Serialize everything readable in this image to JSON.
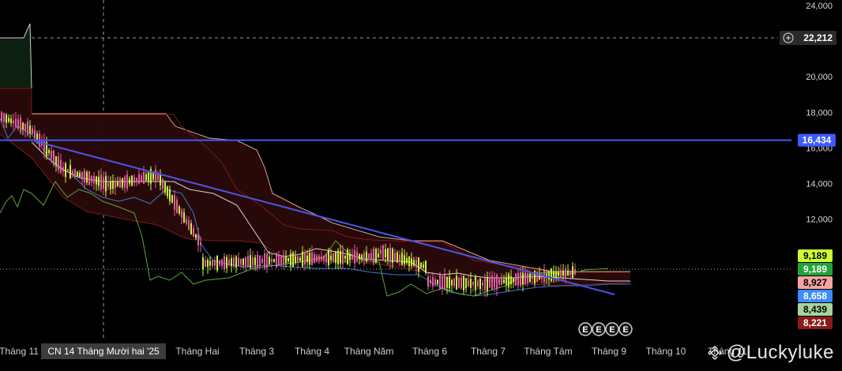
{
  "chart_data": {
    "type": "candlestick",
    "y_axis": {
      "ticks": [
        "24,000",
        "20,000",
        "18,000",
        "16,000",
        "14,000",
        "12,000"
      ],
      "tick_values": [
        24000,
        20000,
        18000,
        16000,
        14000,
        12000
      ],
      "ylim": [
        7300,
        24000
      ]
    },
    "x_axis": {
      "labels": [
        "Tháng 11",
        "Tháng Hai",
        "Tháng 3",
        "Tháng 4",
        "Tháng Năm",
        "Tháng 6",
        "Tháng 7",
        "Tháng Tám",
        "Tháng 9",
        "Tháng 10",
        "Tháng 11"
      ],
      "crosshair_label": "CN 14 Tháng Mười hai '25"
    },
    "crosshair_price": "22,212",
    "horizontal_line": {
      "value": 16434,
      "label": "16,434",
      "color": "#3d5afe"
    },
    "trendline": {
      "from": {
        "date": "mid Nov '24",
        "price": 16400
      },
      "to": {
        "date": "early Sep '25",
        "price": 8450
      },
      "color": "#4a55e8"
    },
    "price_badges": [
      {
        "label": "9,189",
        "bg": "#ccff33",
        "fg": "#000000",
        "role": "last-price"
      },
      {
        "label": "9,189",
        "bg": "#22a33a",
        "fg": "#ffffff",
        "role": "tenkan-sen"
      },
      {
        "label": "8,927",
        "bg": "#f4a3a3",
        "fg": "#000000",
        "role": "senkou-span-b"
      },
      {
        "label": "8,658",
        "bg": "#3d8bfd",
        "fg": "#ffffff",
        "role": "kijun-sen"
      },
      {
        "label": "8,439",
        "bg": "#a3d69a",
        "fg": "#000000",
        "role": "chikou"
      },
      {
        "label": "8,221",
        "bg": "#8b1a1a",
        "fg": "#ffffff",
        "role": "senkou-span-a"
      }
    ],
    "event_markers": [
      "E",
      "E",
      "E",
      "E"
    ],
    "colors": {
      "background": "#000000",
      "candle_up": "#c8f542",
      "candle_down": "#e060a0",
      "cloud_bear": "#2a0a0a",
      "cloud_bull": "#0c1f10",
      "tenkan": "#3a7bd5",
      "kijun": "#7a1a1a",
      "chikou": "#5aa83a"
    }
  },
  "watermark": "@Luckyluke"
}
